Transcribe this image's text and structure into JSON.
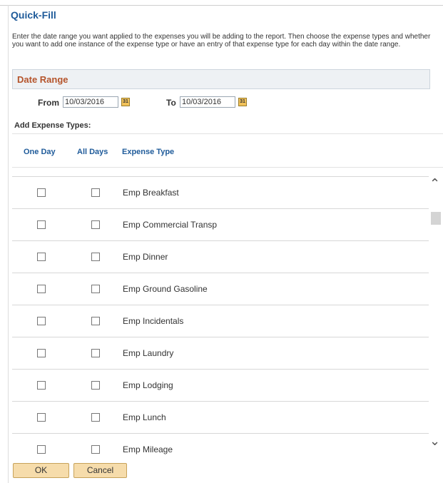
{
  "page": {
    "title": "Quick-Fill",
    "instructions": "Enter the date range you want applied to the expenses you will be adding to the report. Then choose the expense types and whether you want to add one instance of the expense type or have an entry of that expense type for each day within the date range."
  },
  "date_range": {
    "title": "Date Range",
    "from_label": "From",
    "from_value": "10/03/2016",
    "to_label": "To",
    "to_value": "10/03/2016",
    "calendar_glyph": "31"
  },
  "expense_types": {
    "title": "Add Expense Types:",
    "columns": [
      "One Day",
      "All Days",
      "Expense Type"
    ],
    "rows": [
      {
        "name": "Emp Breakfast"
      },
      {
        "name": "Emp Commercial Transp"
      },
      {
        "name": "Emp Dinner"
      },
      {
        "name": "Emp Ground Gasoline"
      },
      {
        "name": "Emp Incidentals"
      },
      {
        "name": "Emp Laundry"
      },
      {
        "name": "Emp Lodging"
      },
      {
        "name": "Emp Lunch"
      },
      {
        "name": "Emp Mileage"
      }
    ]
  },
  "buttons": {
    "ok": "OK",
    "cancel": "Cancel"
  },
  "icons": {
    "calendar": "calendar-icon",
    "scroll_up": "chevron-up-icon",
    "scroll_down": "chevron-down-icon"
  }
}
